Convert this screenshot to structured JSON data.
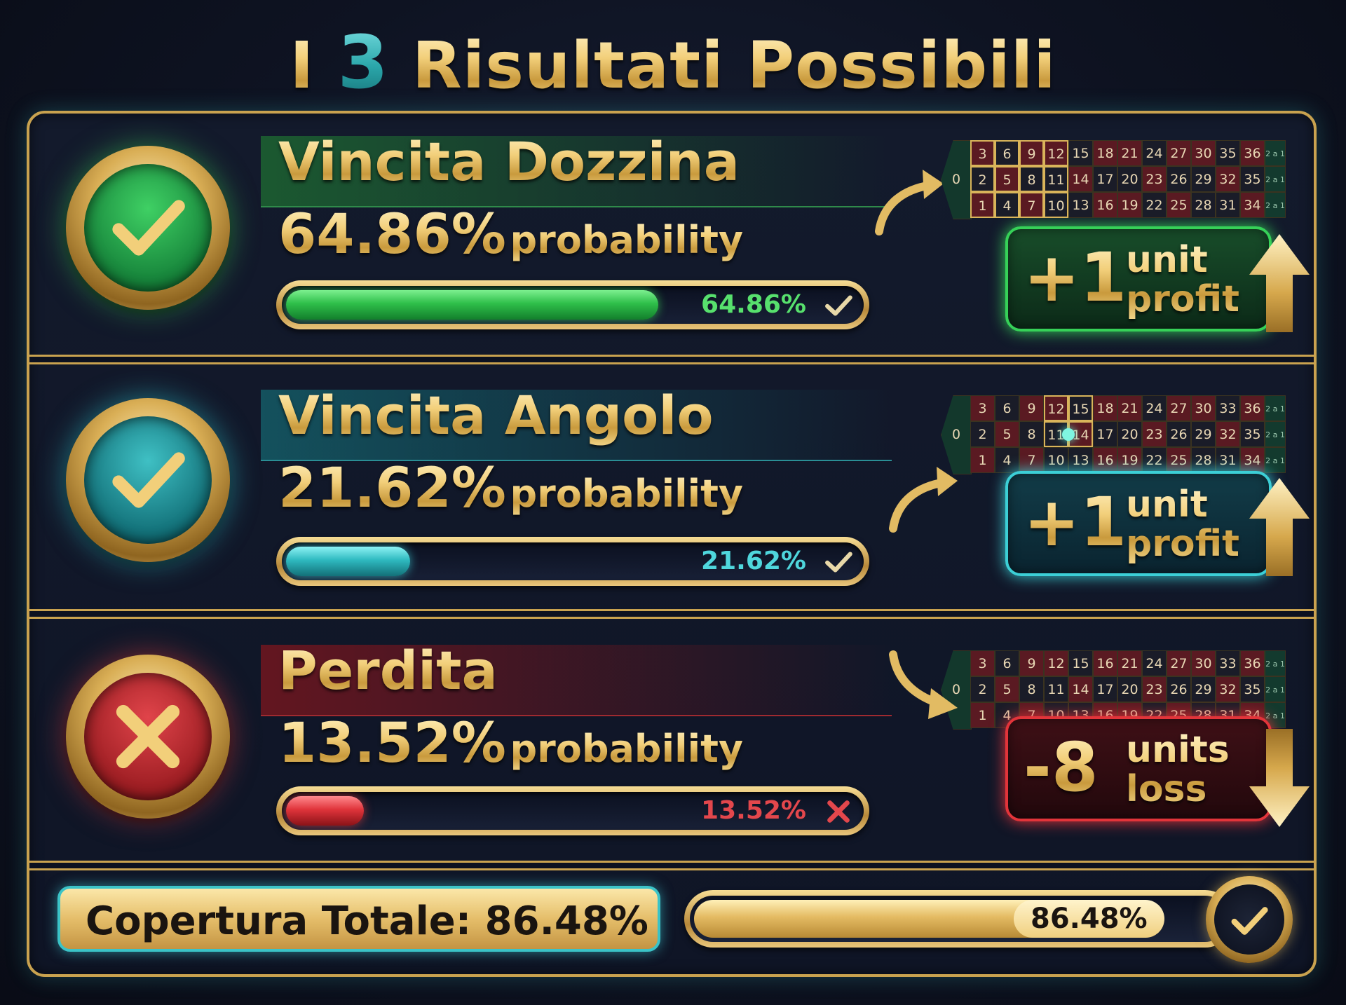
{
  "title": {
    "prefix": "I",
    "number": "3",
    "suffix": "Risultati Possibili"
  },
  "colors": {
    "gold": "#e5be6a",
    "green": "#2fc24a",
    "teal": "#2fb9c0",
    "red": "#e0373d"
  },
  "outcomes": [
    {
      "name": "Vincita Dozzina",
      "prob_value": "64.86%",
      "prob_word": "probability",
      "bar_label": "64.86%",
      "fill_fraction": 0.6486,
      "status_icon": "check-icon",
      "profit_value": "+1",
      "profit_line1": "unit",
      "profit_line2": "profit",
      "arrow_icon": "arrow-up-icon"
    },
    {
      "name": "Vincita Angolo",
      "prob_value": "21.62%",
      "prob_word": "probability",
      "bar_label": "21.62%",
      "fill_fraction": 0.2162,
      "status_icon": "check-icon",
      "profit_value": "+1",
      "profit_line1": "unit",
      "profit_line2": "profit",
      "arrow_icon": "arrow-up-icon"
    },
    {
      "name": "Perdita",
      "prob_value": "13.52%",
      "prob_word": "probability",
      "bar_label": "13.52%",
      "fill_fraction": 0.1352,
      "status_icon": "x-icon",
      "profit_value": "-8",
      "profit_line1": "units",
      "profit_line2": "loss",
      "arrow_icon": "arrow-down-icon"
    }
  ],
  "roulette": {
    "zero": "0",
    "top_row": [
      "3",
      "6",
      "9",
      "12",
      "15",
      "18",
      "21",
      "24",
      "27",
      "30",
      "33",
      "36"
    ],
    "mid_row": [
      "2",
      "5",
      "8",
      "11",
      "14",
      "17",
      "20",
      "23",
      "26",
      "29",
      "32",
      "35"
    ],
    "bot_row": [
      "1",
      "4",
      "7",
      "10",
      "13",
      "16",
      "19",
      "22",
      "25",
      "28",
      "31",
      "34"
    ],
    "column_label": "2 a 1",
    "red_numbers": [
      "1",
      "3",
      "5",
      "7",
      "9",
      "12",
      "14",
      "16",
      "18",
      "19",
      "21",
      "23",
      "25",
      "27",
      "30",
      "32",
      "34",
      "36"
    ],
    "dozen_highlight": [
      "1",
      "2",
      "3",
      "4",
      "5",
      "6",
      "7",
      "8",
      "9",
      "10",
      "11",
      "12"
    ],
    "corner_highlight": [
      "11",
      "12",
      "14",
      "15"
    ],
    "board1_top_row": [
      "3",
      "6",
      "9",
      "12",
      "15",
      "18",
      "21",
      "24",
      "27",
      "30",
      "35",
      "36"
    ],
    "board3_top_row": [
      "3",
      "6",
      "9",
      "12",
      "15",
      "16",
      "21",
      "24",
      "27",
      "30",
      "33",
      "36"
    ]
  },
  "coverage": {
    "label": "Copertura Totale: 86.48%",
    "bar_value": "86.48%",
    "fill_fraction": 0.8648
  }
}
